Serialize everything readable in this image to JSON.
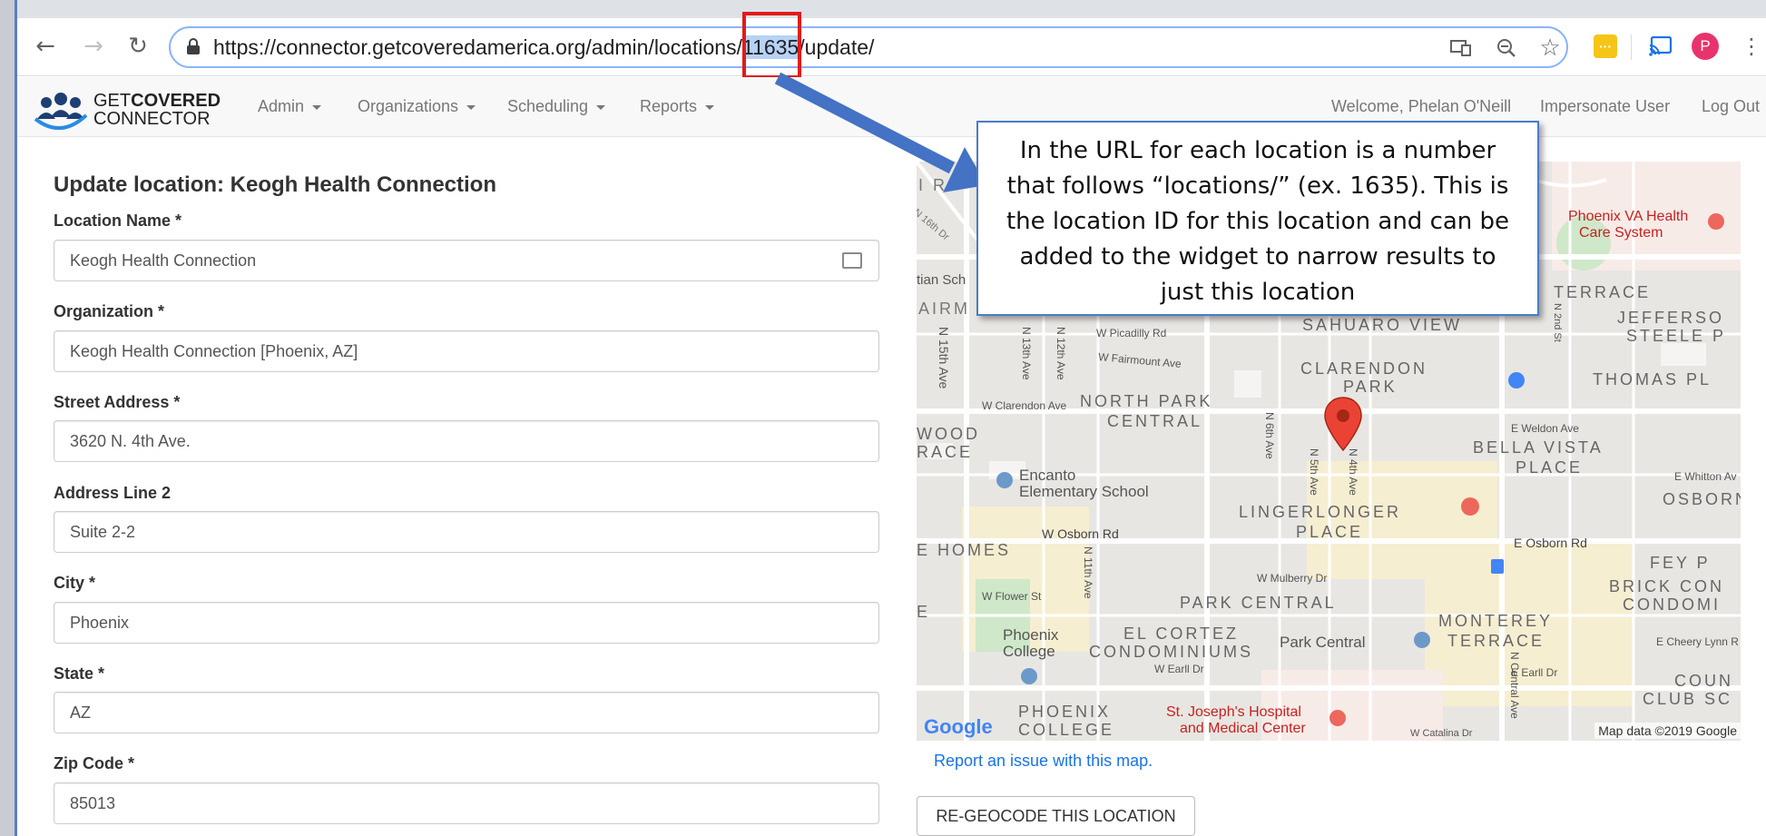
{
  "browser": {
    "url_before": "https://connector.getcoveredamerica.org/admin/locations/",
    "url_highlight": "11635",
    "url_after": "/update/",
    "profile_initial": "P"
  },
  "app": {
    "logo_light": "GET",
    "logo_bold": "COVERED",
    "logo_line2": "CONNECTOR",
    "menus": [
      "Admin",
      "Organizations",
      "Scheduling",
      "Reports"
    ],
    "welcome": "Welcome, Phelan O'Neill",
    "impersonate": "Impersonate User",
    "logout": "Log Out"
  },
  "form": {
    "title": "Update location:  Keogh Health Connection",
    "fields": [
      {
        "label": "Location Name *",
        "value": "Keogh Health Connection"
      },
      {
        "label": "Organization *",
        "value": "Keogh Health Connection [Phoenix, AZ]"
      },
      {
        "label": "Street Address *",
        "value": "3620 N. 4th Ave."
      },
      {
        "label": "Address Line 2",
        "value": "Suite 2-2"
      },
      {
        "label": "City *",
        "value": "Phoenix"
      },
      {
        "label": "State *",
        "value": "AZ"
      },
      {
        "label": "Zip Code *",
        "value": "85013"
      }
    ]
  },
  "map": {
    "report_link": "Report an issue with this map.",
    "regeocode_button": "RE-GEOCODE THIS LOCATION",
    "attribution": "Map data ©2019 Google",
    "google": "Google",
    "labels": {
      "va": "Phoenix VA Health",
      "va2": "Care System",
      "terrace": "TERRACE",
      "jefferson": "JEFFERSO",
      "steele": "STEELE P",
      "sahuaro": "SAHUARO VIEW",
      "clarendon": "CLARENDON",
      "park": "PARK",
      "thomas": "THOMAS PL",
      "northpark": "NORTH PARK",
      "central": "CENTRAL",
      "wood": "WOOD",
      "race": "RACE",
      "bellavista": "BELLA VISTA",
      "place": "PLACE",
      "encanto": "Encanto",
      "elementary": "Elementary School",
      "lingerlonger": "LINGERLONGER",
      "lplace": "PLACE",
      "osborn": "OSBORN",
      "homes": "E HOMES",
      "fey": "FEY P",
      "brick": "BRICK CON",
      "condomi": "CONDOMI",
      "parkcentral": "PARK CENTRAL",
      "monterey": "MONTEREY",
      "mterrace": "TERRACE",
      "elcortez": "EL CORTEZ",
      "condominiums": "CONDOMINIUMS",
      "parkcentral2": "Park Central",
      "phoenixcollege": "Phoenix",
      "college": "College",
      "country": "COUN",
      "club": "CLUB SC",
      "phoenixC": "PHOENIX",
      "collegeC": "COLLEGE",
      "stjoseph": "St. Joseph's Hospital",
      "medical": "and Medical Center",
      "ir": "I R",
      "aim": "AIRM",
      "tian": "tian Sch",
      "n16": "N 16th Dr",
      "n15ave": "N 15th Ave",
      "n13ave": "N 13th Ave",
      "n12ave": "N 12th Ave",
      "piccadilly": "W Picadilly Rd",
      "fairmount": "W Fairmount Ave",
      "clarendonave": "W Clarendon Ave",
      "weldon": "E Weldon Ave",
      "whitton": "E Whitton Av",
      "wosborn": "W Osborn Rd",
      "eosborn": "E Osborn Rd",
      "flower": "W Flower St",
      "mulberry": "W Mulberry Dr",
      "earll": "W Earll Dr",
      "eearll": "E Earll Dr",
      "cheery": "E Cheery Lynn R",
      "catalina": "W Catalina Dr",
      "n5ave": "N 5th Ave",
      "n4ave": "N 4th Ave",
      "n6ave": "N 6th Ave",
      "n2nd": "N 2nd St",
      "ncentral": "N Central Ave",
      "n11ave": "N 11th Ave",
      "e": "E"
    }
  },
  "callout": {
    "text": "In the URL for each location is a number that follows “locations/” (ex. 1635). This is the location ID for this location and can be added to the widget to narrow results to just this location"
  }
}
